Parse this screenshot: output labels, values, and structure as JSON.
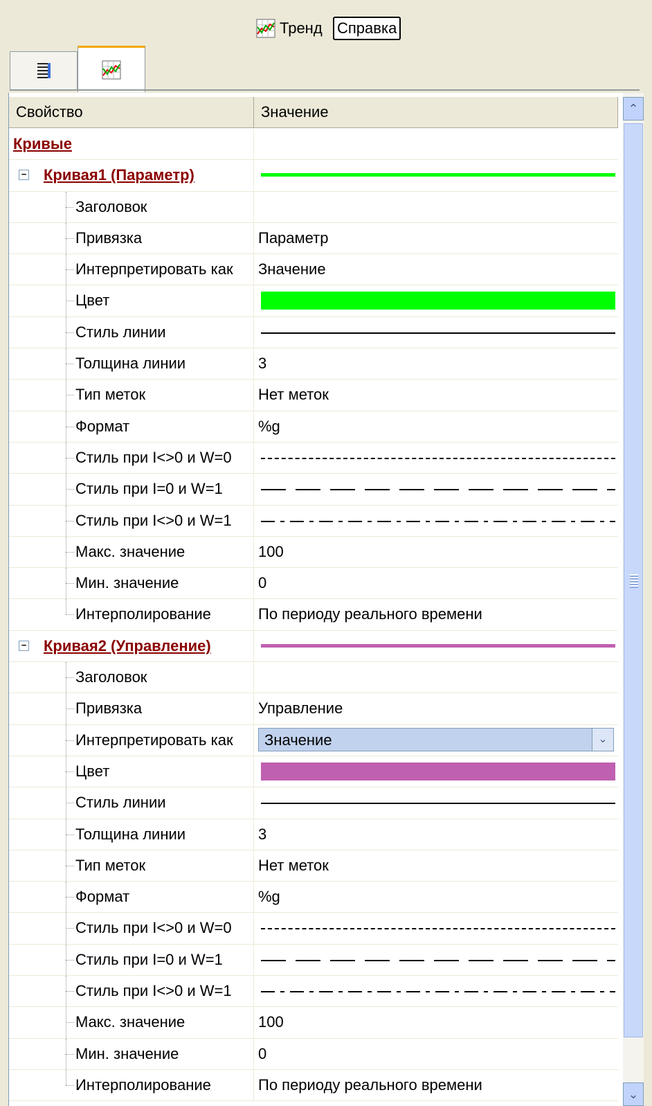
{
  "toolbar": {
    "trend_label": "Тренд",
    "help_label": "Справка",
    "trend_icon": "trend-chart-icon"
  },
  "tabs": [
    {
      "icon": "list-icon"
    },
    {
      "icon": "trend-chart-icon",
      "active": true
    }
  ],
  "grid": {
    "headers": {
      "property": "Свойство",
      "value": "Значение"
    },
    "section_label": "Кривые",
    "curves": [
      {
        "label": "Кривая1 (Параметр)",
        "color": "#00ff00",
        "props": {
          "title": {
            "name": "Заголовок",
            "value": ""
          },
          "binding": {
            "name": "Привязка",
            "value": "Параметр"
          },
          "interpret": {
            "name": "Интерпретировать как",
            "value": "Значение"
          },
          "color": {
            "name": "Цвет"
          },
          "line_style": {
            "name": "Стиль линии"
          },
          "line_width": {
            "name": "Толщина линии",
            "value": "3"
          },
          "marker_type": {
            "name": "Тип меток",
            "value": "Нет меток"
          },
          "format": {
            "name": "Формат",
            "value": "%g"
          },
          "style1": {
            "name": "Стиль при I<>0 и W=0"
          },
          "style2": {
            "name": "Стиль при I=0 и W=1"
          },
          "style3": {
            "name": "Стиль при I<>0 и W=1"
          },
          "max": {
            "name": "Макс. значение",
            "value": "100"
          },
          "min": {
            "name": "Мин. значение",
            "value": "0"
          },
          "interp": {
            "name": "Интерполирование",
            "value": "По периоду реального времени"
          }
        }
      },
      {
        "label": "Кривая2 (Управление)",
        "color": "#c060b0",
        "props": {
          "title": {
            "name": "Заголовок",
            "value": ""
          },
          "binding": {
            "name": "Привязка",
            "value": "Управление"
          },
          "interpret": {
            "name": "Интерпретировать как",
            "value": "Значение"
          },
          "color": {
            "name": "Цвет"
          },
          "line_style": {
            "name": "Стиль линии"
          },
          "line_width": {
            "name": "Толщина линии",
            "value": "3"
          },
          "marker_type": {
            "name": "Тип меток",
            "value": "Нет меток"
          },
          "format": {
            "name": "Формат",
            "value": "%g"
          },
          "style1": {
            "name": "Стиль при I<>0 и W=0"
          },
          "style2": {
            "name": "Стиль при I=0 и W=1"
          },
          "style3": {
            "name": "Стиль при I<>0 и W=1"
          },
          "max": {
            "name": "Макс. значение",
            "value": "100"
          },
          "min": {
            "name": "Мин. значение",
            "value": "0"
          },
          "interp": {
            "name": "Интерполирование",
            "value": "По периоду реального времени"
          }
        }
      }
    ]
  }
}
